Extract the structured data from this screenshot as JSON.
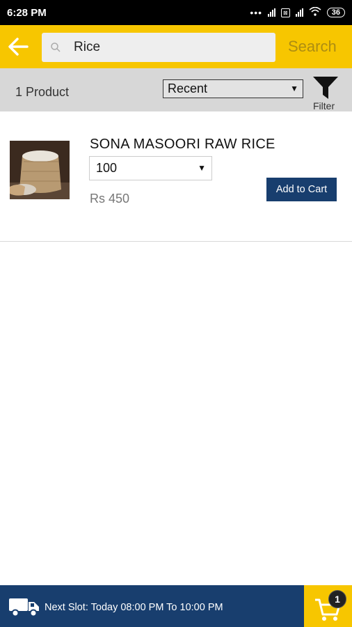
{
  "status_bar": {
    "time": "6:28 PM",
    "battery": "36",
    "network_badge": "4G"
  },
  "header": {
    "search_value": "Rice",
    "search_label": "Search"
  },
  "filter_bar": {
    "product_count": "1 Product",
    "sort_selected": "Recent",
    "filter_label": "Filter"
  },
  "products": [
    {
      "name": "SONA MASOORI RAW RICE",
      "quantity_selected": "100",
      "price": "Rs 450",
      "add_button": "Add to Cart"
    }
  ],
  "footer": {
    "slot_text": "Next Slot: Today 08:00 PM To 10:00 PM",
    "cart_count": "1"
  },
  "colors": {
    "accent_yellow": "#f7c600",
    "navy": "#183e6e",
    "filter_bg": "#d7d7d7"
  },
  "icons": {
    "back": "arrow-left-icon",
    "search": "magnifier-icon",
    "filter": "funnel-icon",
    "truck": "truck-icon",
    "cart": "shopping-cart-icon"
  }
}
